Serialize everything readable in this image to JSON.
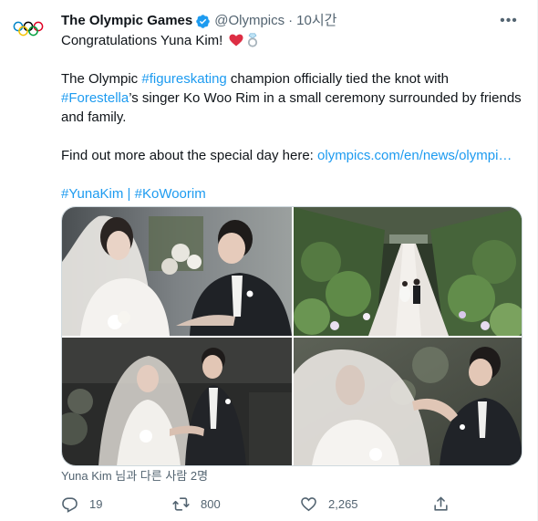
{
  "author": {
    "display_name": "The Olympic Games",
    "handle": "@Olympics",
    "separator": "·",
    "time": "10시간",
    "verified": true
  },
  "tweet": {
    "line1": "Congratulations Yuna Kim!",
    "p2_a": "The Olympic ",
    "p2_tag1": "#figureskating",
    "p2_b": " champion officially tied the knot with",
    "p2_tag2": "#Forestella",
    "p2_c": "’s singer Ko Woo Rim in a small ceremony surrounded by friends and family.",
    "p3_a": "Find out more about the special day here: ",
    "p3_link": "olympics.com/en/news/olympi…",
    "tag_yuna": "#YunaKim",
    "tag_sep": " | ",
    "tag_ko": "#KoWoorim"
  },
  "photo_tags": "Yuna Kim 님과 다른 사람 2명",
  "actions": {
    "replies": "19",
    "retweets": "800",
    "likes": "2,265"
  },
  "colors": {
    "link": "#1d9bf0",
    "verified": "#1d9bf0",
    "muted": "#536471",
    "heart": "#e0245e"
  },
  "icons": {
    "avatar": "olympic-rings-icon",
    "more": "more-icon",
    "reply": "reply-icon",
    "retweet": "retweet-icon",
    "like": "like-icon",
    "share": "share-icon"
  }
}
